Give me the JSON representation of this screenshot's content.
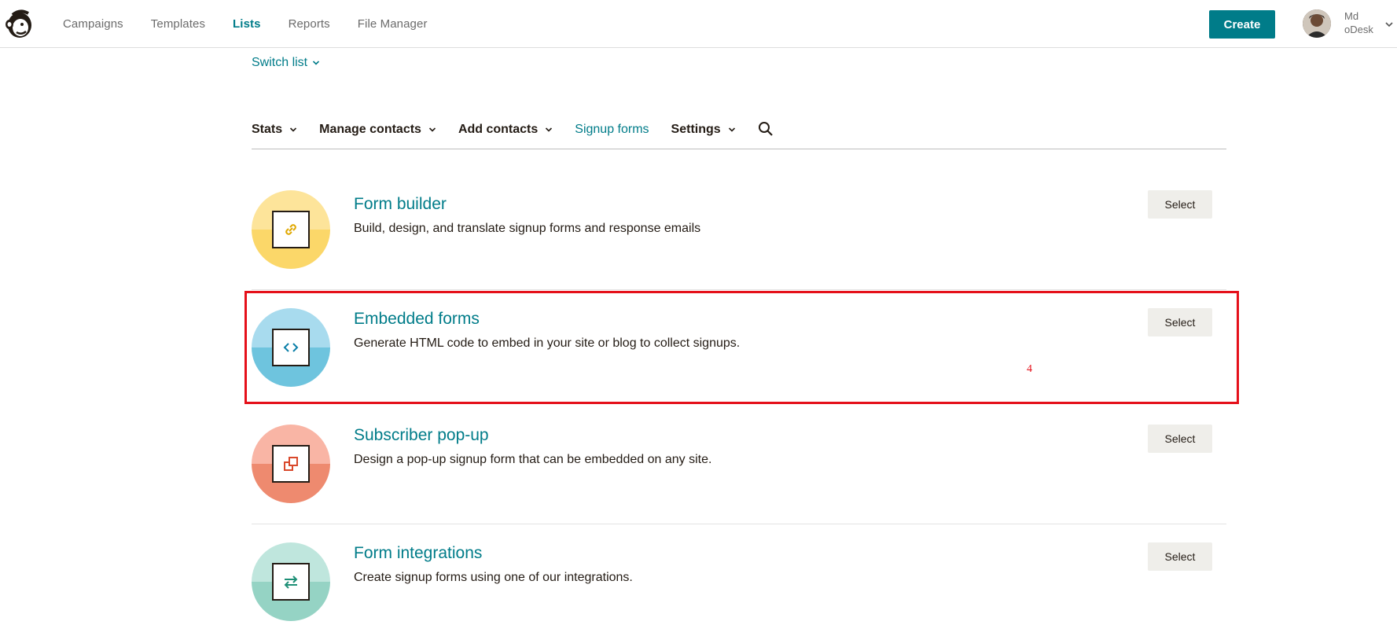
{
  "nav": {
    "items": [
      {
        "label": "Campaigns",
        "active": false
      },
      {
        "label": "Templates",
        "active": false
      },
      {
        "label": "Lists",
        "active": true
      },
      {
        "label": "Reports",
        "active": false
      },
      {
        "label": "File Manager",
        "active": false
      }
    ],
    "create_label": "Create",
    "user_line1": "Md",
    "user_line2": "oDesk"
  },
  "switch_list": "Switch list",
  "subnav": {
    "stats": "Stats",
    "manage": "Manage contacts",
    "add": "Add contacts",
    "signup": "Signup forms",
    "settings": "Settings"
  },
  "forms": [
    {
      "title": "Form builder",
      "description": "Build, design, and translate signup forms and response emails",
      "select_label": "Select",
      "icon": "link-icon",
      "color_top": "#fde49a",
      "color_bottom": "#fbd769"
    },
    {
      "title": "Embedded forms",
      "description": "Generate HTML code to embed in your site or blog to collect signups.",
      "select_label": "Select",
      "icon": "code-icon",
      "color_top": "#a8dbee",
      "color_bottom": "#6ec4de"
    },
    {
      "title": "Subscriber pop-up",
      "description": "Design a pop-up signup form that can be embedded on any site.",
      "select_label": "Select",
      "icon": "popup-icon",
      "color_top": "#f9b5a5",
      "color_bottom": "#ee8a6f"
    },
    {
      "title": "Form integrations",
      "description": "Create signup forms using one of our integrations.",
      "select_label": "Select",
      "icon": "arrows-exchange-icon",
      "color_top": "#bfe6dd",
      "color_bottom": "#95d3c4"
    }
  ],
  "annotation": "4",
  "colors": {
    "accent": "#007c89",
    "highlight": "#e5101a"
  }
}
